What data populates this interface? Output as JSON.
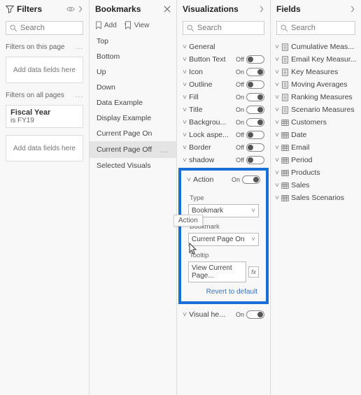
{
  "filters": {
    "title": "Filters",
    "search_placeholder": "Search",
    "section_page": "Filters on this page",
    "add_fields": "Add data fields here",
    "section_all": "Filters on all pages",
    "card_title": "Fiscal Year",
    "card_sub": "is FY19"
  },
  "bookmarks": {
    "title": "Bookmarks",
    "add_label": "Add",
    "view_label": "View",
    "items": [
      {
        "label": "Top"
      },
      {
        "label": "Bottom"
      },
      {
        "label": "Up"
      },
      {
        "label": "Down"
      },
      {
        "label": "Data Example"
      },
      {
        "label": "Display Example"
      },
      {
        "label": "Current Page On"
      },
      {
        "label": "Current Page Off"
      },
      {
        "label": "Selected Visuals"
      }
    ],
    "selected_index": 7
  },
  "viz": {
    "title": "Visualizations",
    "search_placeholder": "Search",
    "groups": [
      {
        "label": "General",
        "toggle": null
      },
      {
        "label": "Button Text",
        "toggle": false
      },
      {
        "label": "Icon",
        "toggle": true
      },
      {
        "label": "Outline",
        "toggle": false
      },
      {
        "label": "Fill",
        "toggle": true
      },
      {
        "label": "Title",
        "toggle": true
      },
      {
        "label": "Backgrou...",
        "toggle": true
      },
      {
        "label": "Lock aspe...",
        "toggle": false
      },
      {
        "label": "Border",
        "toggle": false
      },
      {
        "label": "shadow",
        "toggle": false
      }
    ],
    "tooltip_flyout": "Action",
    "action_label": "Action",
    "action_toggle": true,
    "type_label": "Type",
    "type_value": "Bookmark",
    "bookmark_label": "Bookmark",
    "bookmark_value": "Current Page On",
    "tooltip_label": "Tooltip",
    "tooltip_value": "View Current Page...",
    "revert": "Revert to default",
    "tail_group": {
      "label": "Visual he...",
      "toggle": true
    },
    "on_text": "On",
    "off_text": "Off"
  },
  "fields": {
    "title": "Fields",
    "search_placeholder": "Search",
    "items": [
      {
        "label": "Cumulative Meas...",
        "icon": "calc"
      },
      {
        "label": "Email Key Measur...",
        "icon": "calc"
      },
      {
        "label": "Key Measures",
        "icon": "calc"
      },
      {
        "label": "Moving Averages",
        "icon": "calc"
      },
      {
        "label": "Ranking Measures",
        "icon": "calc"
      },
      {
        "label": "Scenario Measures",
        "icon": "calc"
      },
      {
        "label": "Customers",
        "icon": "table"
      },
      {
        "label": "Date",
        "icon": "table"
      },
      {
        "label": "Email",
        "icon": "table"
      },
      {
        "label": "Period",
        "icon": "table"
      },
      {
        "label": "Products",
        "icon": "table"
      },
      {
        "label": "Sales",
        "icon": "table"
      },
      {
        "label": "Sales Scenarios",
        "icon": "table"
      }
    ]
  }
}
